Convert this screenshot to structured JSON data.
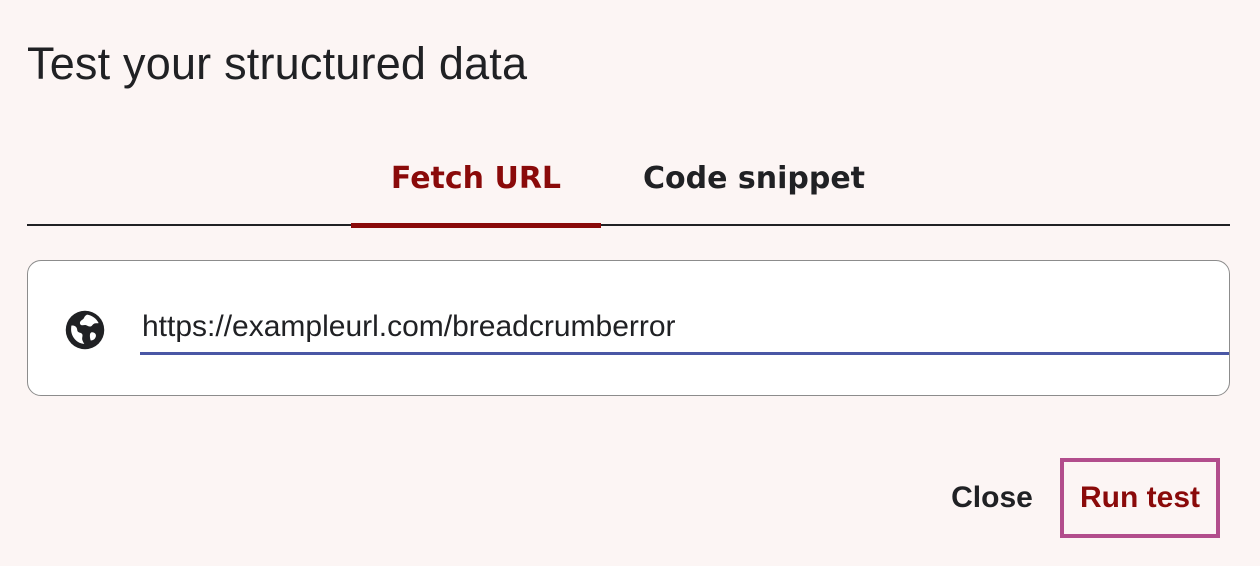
{
  "dialog": {
    "title": "Test your structured data"
  },
  "tabs": [
    {
      "label": "Fetch URL",
      "active": true
    },
    {
      "label": "Code snippet",
      "active": false
    }
  ],
  "url_field": {
    "icon": "globe-icon",
    "value": "https://exampleurl.com/breadcrumberror"
  },
  "actions": {
    "close_label": "Close",
    "run_label": "Run test"
  },
  "colors": {
    "accent": "#8a0a0a",
    "input_underline": "#4a57a5",
    "highlight_border": "#b24d8c",
    "background": "#fcf5f4"
  }
}
